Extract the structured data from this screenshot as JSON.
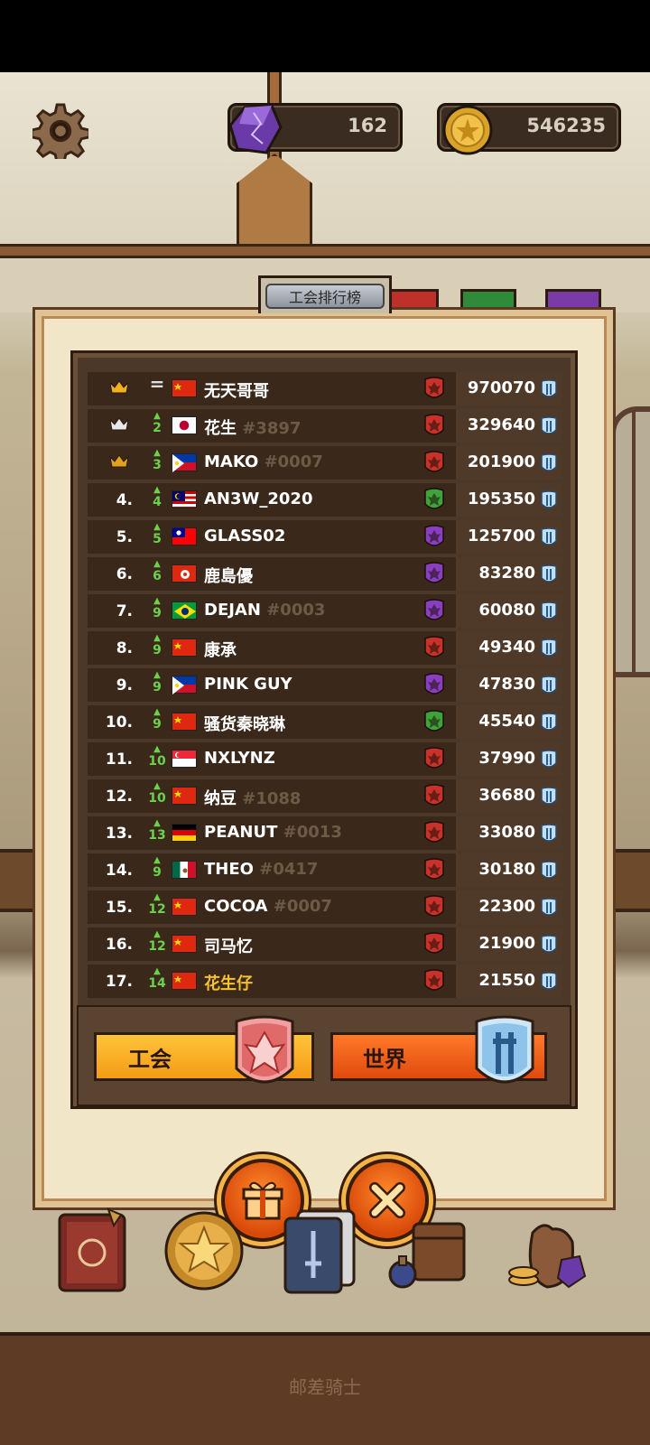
{
  "currency": {
    "gems": "162",
    "coins": "546235"
  },
  "panel": {
    "title": "工会排行榜"
  },
  "leaderboard": [
    {
      "rank": "",
      "crown": "gold",
      "delta": "=",
      "flag": "cn",
      "name": "无天哥哥",
      "tag": "",
      "emblem": "red",
      "score": "970070"
    },
    {
      "rank": "",
      "crown": "silver",
      "delta": "2",
      "flag": "jp",
      "name": "花生",
      "tag": "#3897",
      "emblem": "red",
      "score": "329640"
    },
    {
      "rank": "",
      "crown": "bronze",
      "delta": "3",
      "flag": "ph",
      "name": "MAKO",
      "tag": "#0007",
      "emblem": "red",
      "score": "201900"
    },
    {
      "rank": "4.",
      "delta": "4",
      "flag": "my",
      "name": "AN3W_2020",
      "tag": "",
      "emblem": "green",
      "score": "195350"
    },
    {
      "rank": "5.",
      "delta": "5",
      "flag": "tw",
      "name": "GLASS02",
      "tag": "",
      "emblem": "purple",
      "score": "125700"
    },
    {
      "rank": "6.",
      "delta": "6",
      "flag": "hk",
      "name": "鹿島優",
      "tag": "",
      "emblem": "purple",
      "score": "83280"
    },
    {
      "rank": "7.",
      "delta": "9",
      "flag": "br",
      "name": "DEJAN",
      "tag": "#0003",
      "emblem": "purple",
      "score": "60080"
    },
    {
      "rank": "8.",
      "delta": "9",
      "flag": "cn",
      "name": "康承",
      "tag": "",
      "emblem": "red",
      "score": "49340"
    },
    {
      "rank": "9.",
      "delta": "9",
      "flag": "ph",
      "name": "PINK GUY",
      "tag": "",
      "emblem": "purple",
      "score": "47830"
    },
    {
      "rank": "10.",
      "delta": "9",
      "flag": "cn",
      "name": "骚货秦晓琳",
      "tag": "",
      "emblem": "green",
      "score": "45540"
    },
    {
      "rank": "11.",
      "delta": "10",
      "flag": "sg",
      "name": "NXLYNZ",
      "tag": "",
      "emblem": "red",
      "score": "37990"
    },
    {
      "rank": "12.",
      "delta": "10",
      "flag": "cn",
      "name": "纳豆",
      "tag": "#1088",
      "emblem": "red",
      "score": "36680"
    },
    {
      "rank": "13.",
      "delta": "13",
      "flag": "de",
      "name": "PEANUT",
      "tag": "#0013",
      "emblem": "red",
      "score": "33080"
    },
    {
      "rank": "14.",
      "delta": "9",
      "flag": "mx",
      "name": "THEO",
      "tag": "#0417",
      "emblem": "red",
      "score": "30180"
    },
    {
      "rank": "15.",
      "delta": "12",
      "flag": "cn",
      "name": "COCOA",
      "tag": "#0007",
      "emblem": "red",
      "score": "22300"
    },
    {
      "rank": "16.",
      "delta": "12",
      "flag": "cn",
      "name": "司马忆",
      "tag": "",
      "emblem": "red",
      "score": "21900"
    },
    {
      "rank": "17.",
      "delta": "14",
      "flag": "cn",
      "name": "花生仔",
      "tag": "",
      "emblem": "red",
      "score": "21550",
      "highlight": true
    }
  ],
  "tabs": {
    "guild": "工会",
    "world": "世界"
  },
  "footer": {
    "label": "邮差骑士"
  },
  "colors": {
    "emblem_red": "#c8322a",
    "emblem_green": "#3fa23a",
    "emblem_purple": "#8a3fc0",
    "accent_orange": "#f49b16"
  },
  "icons": {
    "settings": "gear-icon",
    "gem": "gem-icon",
    "coin": "coin-icon",
    "gift": "gift-icon",
    "close": "close-icon",
    "book": "book-icon",
    "medal": "medal-icon",
    "cards": "cards-icon",
    "bag": "bag-icon",
    "loot": "loot-icon"
  }
}
